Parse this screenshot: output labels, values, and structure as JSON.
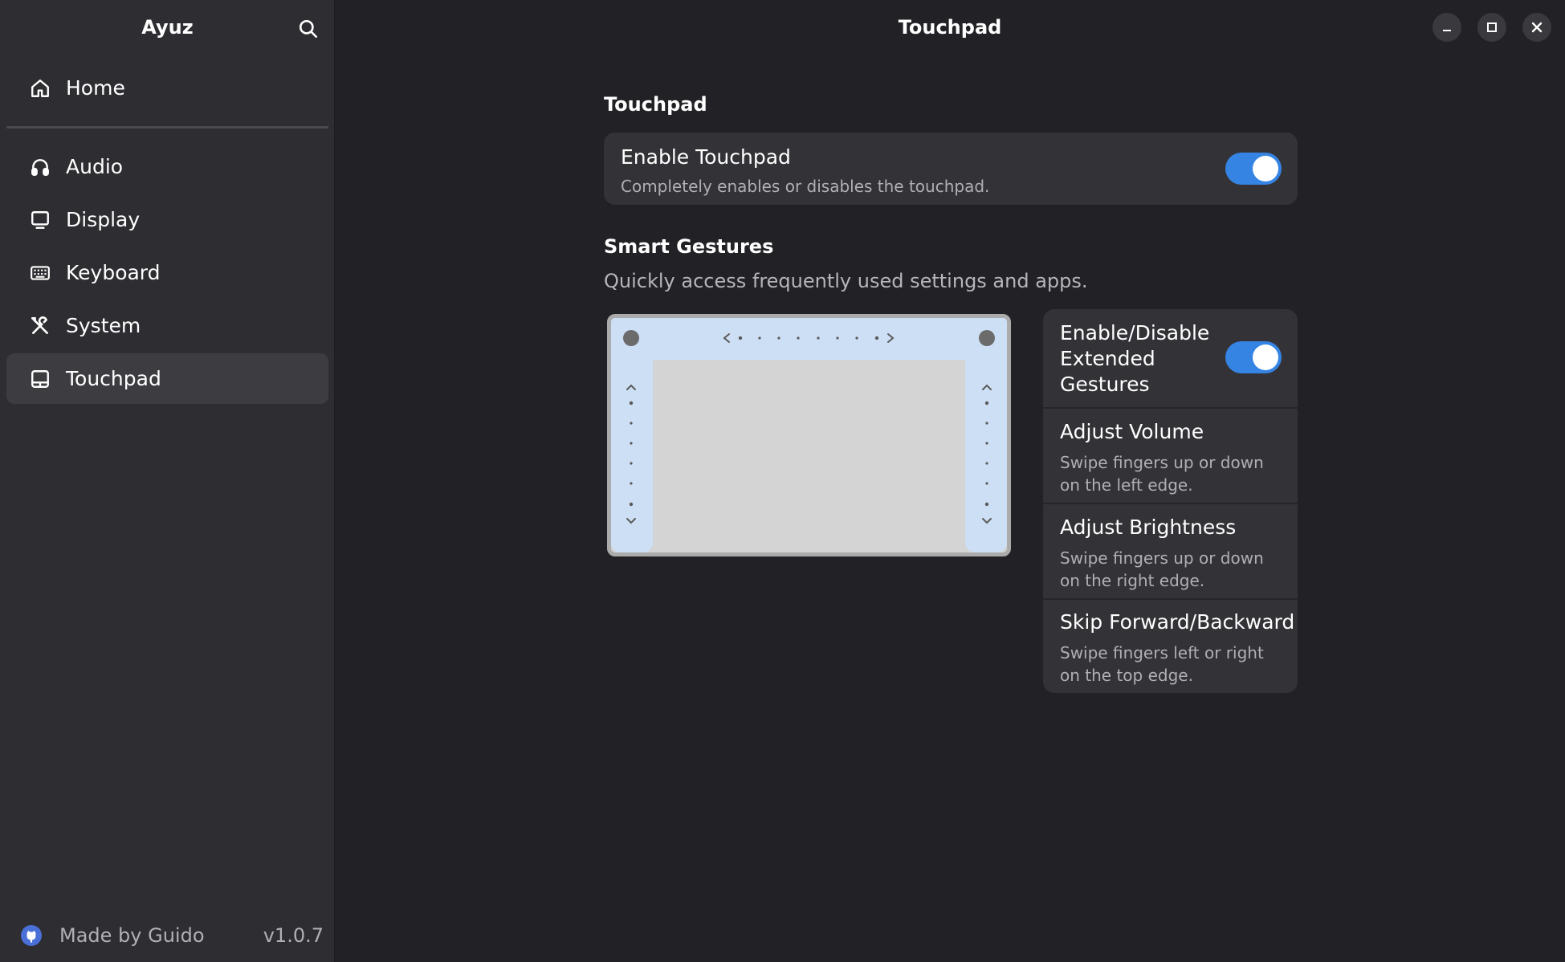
{
  "sidebar": {
    "title": "Ayuz",
    "home_label": "Home",
    "items": [
      {
        "label": "Audio"
      },
      {
        "label": "Display"
      },
      {
        "label": "Keyboard"
      },
      {
        "label": "System"
      },
      {
        "label": "Touchpad"
      }
    ],
    "footer": {
      "made_by": "Made by Guido",
      "version": "v1.0.7"
    }
  },
  "header": {
    "title": "Touchpad"
  },
  "touchpad_section": {
    "title": "Touchpad",
    "enable": {
      "title": "Enable Touchpad",
      "subtitle": "Completely enables or disables the touchpad.",
      "enabled": true
    }
  },
  "gestures_section": {
    "title": "Smart Gestures",
    "subtitle": "Quickly access frequently used settings and apps.",
    "toggle": {
      "title": "Enable/Disable Extended Gestures",
      "enabled": true
    },
    "items": [
      {
        "title": "Adjust Volume",
        "subtitle": "Swipe fingers up or down on the left edge."
      },
      {
        "title": "Adjust Brightness",
        "subtitle": "Swipe fingers up or down on the right edge."
      },
      {
        "title": "Skip Forward/Backward",
        "subtitle": "Swipe fingers left or right on the top edge."
      }
    ]
  },
  "colors": {
    "accent": "#3584e4",
    "sidebar_bg": "#2e2e32",
    "content_bg": "#222226",
    "card_bg": "#333337"
  }
}
